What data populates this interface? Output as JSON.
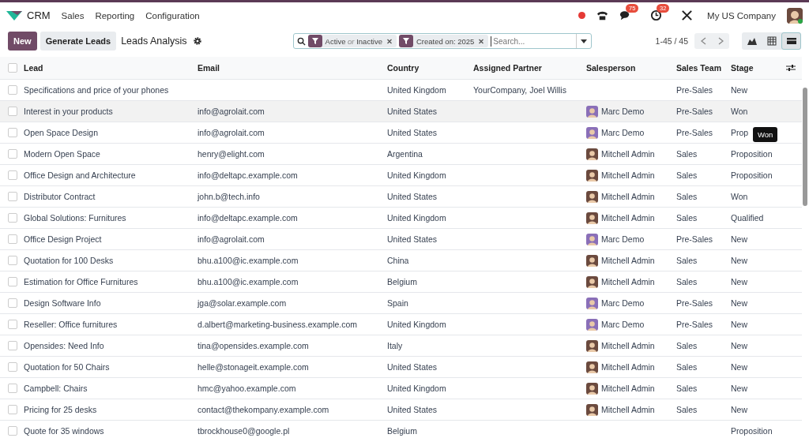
{
  "navbar": {
    "app": "CRM",
    "menus": [
      "Sales",
      "Reporting",
      "Configuration"
    ],
    "messages_badge": "75",
    "activities_badge": "32",
    "company": "My US Company"
  },
  "control_panel": {
    "new_button": "New",
    "generate_button": "Generate Leads",
    "title": "Leads Analysis",
    "facets": [
      {
        "label": "Active",
        "connector": "or",
        "label2": "Inactive"
      },
      {
        "label": "Created on: 2025"
      }
    ],
    "search": {
      "placeholder": "Search..."
    },
    "pager": "1-45 / 45",
    "views": [
      {
        "kind": "graph",
        "selected": false
      },
      {
        "kind": "pivot",
        "selected": false
      },
      {
        "kind": "list",
        "selected": true
      }
    ]
  },
  "table": {
    "all_checked": false,
    "columns": [
      "Lead",
      "Email",
      "Country",
      "Assigned Partner",
      "Salesperson",
      "Sales Team",
      "Stage"
    ],
    "rows": [
      {
        "lead": "Specifications and price of your phones",
        "email": "",
        "country": "United Kingdom",
        "partner": "YourCompany, Joel Willis",
        "salesperson": "",
        "team": "Pre-Sales",
        "stage": "New",
        "hovered": false
      },
      {
        "lead": "Interest in your products",
        "email": "info@agrolait.com",
        "country": "United States",
        "partner": "",
        "salesperson": "Marc Demo",
        "avatar": {
          "color": "#8a6fb8"
        },
        "team": "Pre-Sales",
        "stage": "Won",
        "hovered": true
      },
      {
        "lead": "Open Space Design",
        "email": "info@agrolait.com",
        "country": "United States",
        "partner": "",
        "salesperson": "Marc Demo",
        "avatar": {
          "color": "#8a6fb8"
        },
        "team": "Pre-Sales",
        "stage": "Prop",
        "hovered": false,
        "tooltip": "Won"
      },
      {
        "lead": "Modern Open Space",
        "email": "henry@elight.com",
        "country": "Argentina",
        "partner": "",
        "salesperson": "Mitchell Admin",
        "avatar": {
          "color": "#6b4a3e"
        },
        "team": "Sales",
        "stage": "Proposition",
        "hovered": false
      },
      {
        "lead": "Office Design and Architecture",
        "email": "info@deltapc.example.com",
        "country": "United Kingdom",
        "partner": "",
        "salesperson": "Mitchell Admin",
        "avatar": {
          "color": "#6b4a3e"
        },
        "team": "Sales",
        "stage": "Proposition",
        "hovered": false
      },
      {
        "lead": "Distributor Contract",
        "email": "john.b@tech.info",
        "country": "United States",
        "partner": "",
        "salesperson": "Mitchell Admin",
        "avatar": {
          "color": "#6b4a3e"
        },
        "team": "Sales",
        "stage": "Won",
        "hovered": false
      },
      {
        "lead": "Global Solutions: Furnitures",
        "email": "info@deltapc.example.com",
        "country": "United Kingdom",
        "partner": "",
        "salesperson": "Mitchell Admin",
        "avatar": {
          "color": "#6b4a3e"
        },
        "team": "Sales",
        "stage": "Qualified",
        "hovered": false
      },
      {
        "lead": "Office Design Project",
        "email": "info@agrolait.com",
        "country": "United States",
        "partner": "",
        "salesperson": "Marc Demo",
        "avatar": {
          "color": "#8a6fb8"
        },
        "team": "Pre-Sales",
        "stage": "New",
        "hovered": false
      },
      {
        "lead": "Quotation for 100 Desks",
        "email": "bhu.a100@ic.example.com",
        "country": "China",
        "partner": "",
        "salesperson": "Mitchell Admin",
        "avatar": {
          "color": "#6b4a3e"
        },
        "team": "Sales",
        "stage": "New",
        "hovered": false
      },
      {
        "lead": "Estimation for Office Furnitures",
        "email": "bhu.a100@ic.example.com",
        "country": "Belgium",
        "partner": "",
        "salesperson": "Mitchell Admin",
        "avatar": {
          "color": "#6b4a3e"
        },
        "team": "Sales",
        "stage": "New",
        "hovered": false
      },
      {
        "lead": "Design Software Info",
        "email": "jga@solar.example.com",
        "country": "Spain",
        "partner": "",
        "salesperson": "Marc Demo",
        "avatar": {
          "color": "#8a6fb8"
        },
        "team": "Pre-Sales",
        "stage": "New",
        "hovered": false
      },
      {
        "lead": "Reseller: Office furnitures",
        "email": "d.albert@marketing-business.example.com",
        "country": "United Kingdom",
        "partner": "",
        "salesperson": "Marc Demo",
        "avatar": {
          "color": "#8a6fb8"
        },
        "team": "Pre-Sales",
        "stage": "New",
        "hovered": false
      },
      {
        "lead": "Opensides: Need Info",
        "email": "tina@opensides.example.com",
        "country": "Italy",
        "partner": "",
        "salesperson": "Mitchell Admin",
        "avatar": {
          "color": "#6b4a3e"
        },
        "team": "Sales",
        "stage": "New",
        "hovered": false
      },
      {
        "lead": "Quotation for 50 Chairs",
        "email": "helle@stonageit.example.com",
        "country": "United States",
        "partner": "",
        "salesperson": "Mitchell Admin",
        "avatar": {
          "color": "#6b4a3e"
        },
        "team": "Sales",
        "stage": "New",
        "hovered": false
      },
      {
        "lead": "Campbell: Chairs",
        "email": "hmc@yahoo.example.com",
        "country": "United Kingdom",
        "partner": "",
        "salesperson": "Mitchell Admin",
        "avatar": {
          "color": "#6b4a3e"
        },
        "team": "Sales",
        "stage": "New",
        "hovered": false
      },
      {
        "lead": "Pricing for 25 desks",
        "email": "contact@thekompany.example.com",
        "country": "United States",
        "partner": "",
        "salesperson": "Mitchell Admin",
        "avatar": {
          "color": "#6b4a3e"
        },
        "team": "Sales",
        "stage": "New",
        "hovered": false
      },
      {
        "lead": "Quote for 35 windows",
        "email": "tbrockhouse0@google.pl",
        "country": "Belgium",
        "partner": "",
        "salesperson": "",
        "team": "",
        "stage": "Proposition",
        "hovered": false
      }
    ]
  }
}
